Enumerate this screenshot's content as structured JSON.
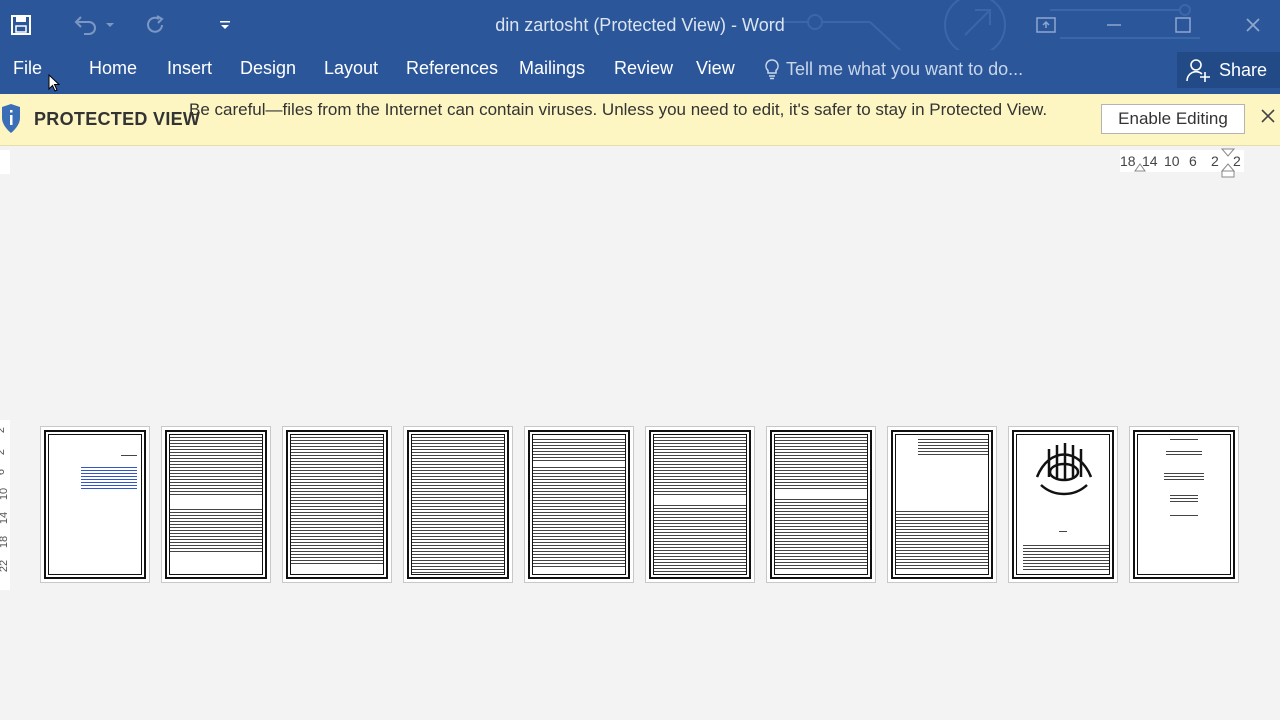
{
  "titlebar": {
    "title": "din zartosht (Protected View) - Word",
    "save_icon": "save-icon",
    "undo_icon": "undo-icon",
    "redo_icon": "redo-icon",
    "qat_icon": "customize-quick-access-icon",
    "ribbon_display_icon": "ribbon-display-options-icon",
    "minimize_icon": "minimize-icon",
    "maximize_icon": "maximize-icon",
    "close_icon": "close-icon"
  },
  "ribbon": {
    "tabs": [
      "File",
      "Home",
      "Insert",
      "Design",
      "Layout",
      "References",
      "Mailings",
      "Review",
      "View"
    ],
    "tell_me": "Tell me what you want to do...",
    "share_label": "Share",
    "accent": "#2b579a"
  },
  "protected_view": {
    "title": "PROTECTED VIEW",
    "message": "Be careful—files from the Internet can contain viruses. Unless you need to edit, it's safer to stay in Protected View.",
    "enable_label": "Enable Editing",
    "background": "#fdf6c3"
  },
  "ruler": {
    "horizontal": [
      "18",
      "14",
      "10",
      "6",
      "2",
      "2"
    ],
    "vertical": [
      "22",
      "18",
      "14",
      "10",
      "6",
      "2",
      "2"
    ]
  },
  "pages": {
    "count": 10
  }
}
